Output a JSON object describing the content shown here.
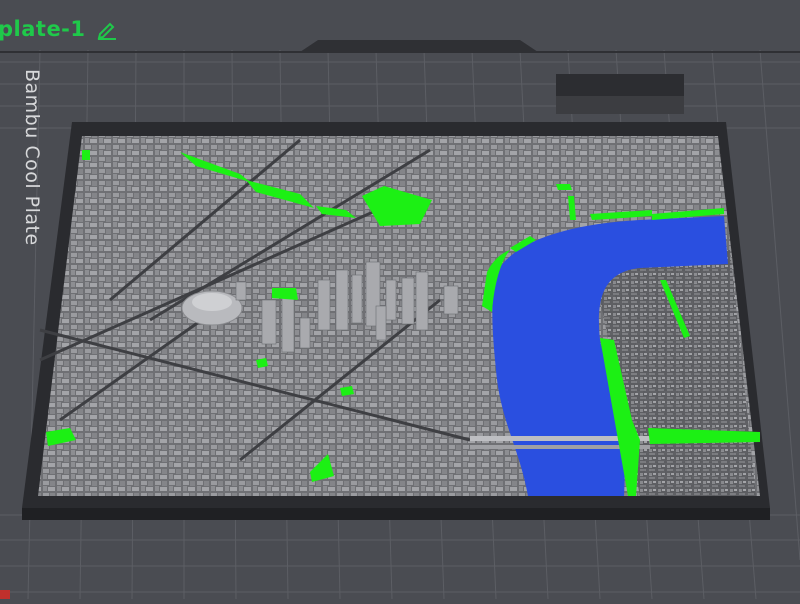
{
  "plate": {
    "name": "plate-1",
    "type_label": "Bambu Cool Plate",
    "edit_icon": "pencil-icon"
  },
  "colors": {
    "background": "#4a4c52",
    "grid_line": "#5c5e64",
    "plate_frame": "#2a2b2f",
    "model_gray": "#7e7f83",
    "water_blue": "#2a4fe0",
    "park_green": "#1cf014",
    "label_green": "#1fc94a"
  }
}
